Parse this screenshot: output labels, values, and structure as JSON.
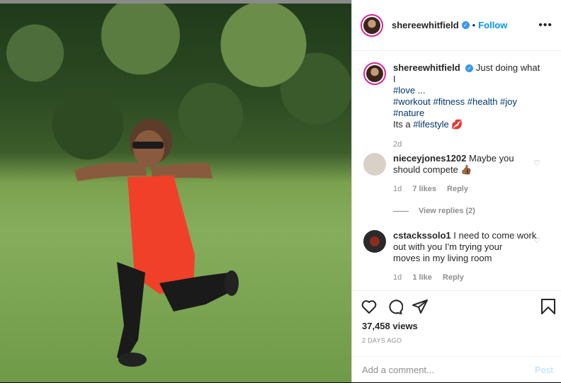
{
  "post": {
    "username": "shereewhitfield",
    "follow_label": "Follow",
    "separator": "•",
    "more_label": "•••"
  },
  "caption": {
    "username": "shereewhitfield",
    "text": "Just doing what I",
    "line2": "#love ...",
    "line3": "#workout #fitness #health #joy",
    "line4": "#nature",
    "line5_prefix": "Its a ",
    "line5_tag": "#lifestyle",
    "emoji": "💋",
    "age": "2d"
  },
  "comments": [
    {
      "username": "nieceyjones1202",
      "text_line1": "Maybe you",
      "text_line2": "should compete",
      "emoji": "👍🏾",
      "age": "1d",
      "likes": "7 likes",
      "reply": "Reply",
      "view_replies": "View replies (2)"
    },
    {
      "username": "cstackssolo1",
      "text_line1": "I need to come work",
      "text_line2": "out with you I'm trying your",
      "text_line3": "moves in my living room",
      "age": "1d",
      "likes": "1 like",
      "reply": "Reply"
    }
  ],
  "stats": {
    "views": "37,458 views",
    "time_ago": "2 DAYS AGO"
  },
  "add_comment": {
    "placeholder": "Add a comment...",
    "post_label": "Post"
  },
  "colors": {
    "accent": "#0095f6",
    "verified": "#3897f0",
    "shirt": "#f0402a"
  }
}
